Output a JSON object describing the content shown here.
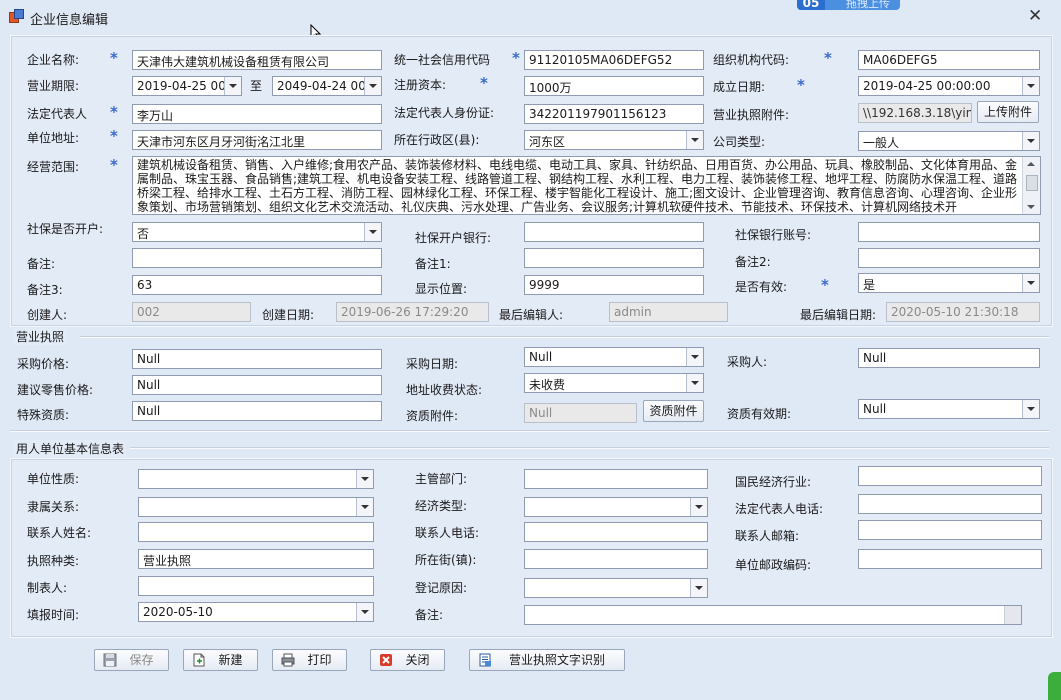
{
  "window": {
    "title": "企业信息编辑",
    "overlay_button": "拖拽上传",
    "overlay_logo": "05"
  },
  "company": {
    "name_label": "企业名称:",
    "name_value": "天津伟大建筑机械设备租赁有限公司",
    "credit_code_label": "统一社会信用代码",
    "credit_code_value": "91120105MA06DEFG52",
    "org_code_label": "组织机构代码:",
    "org_code_value": "MA06DEFG5",
    "term_label": "营业期限:",
    "term_start": "2019-04-25 00:",
    "term_to": "至",
    "term_end": "2049-04-24 00:",
    "capital_label": "注册资本:",
    "capital_value": "1000万",
    "established_label": "成立日期:",
    "established_value": "2019-04-25 00:00:00",
    "legal_rep_label": "法定代表人",
    "legal_rep_value": "李万山",
    "legal_id_label": "法定代表人身份证:",
    "legal_id_value": "342201197901156123",
    "license_attach_label": "营业执照附件:",
    "license_attach_value": "\\\\192.168.3.18\\yin",
    "upload_attach_button": "上传附件",
    "address_label": "单位地址:",
    "address_value": "天津市河东区月牙河街洺江北里",
    "district_label": "所在行政区(县):",
    "district_value": "河东区",
    "company_type_label": "公司类型:",
    "company_type_value": "一般人",
    "scope_label": "经营范围:",
    "scope_value": "建筑机械设备租赁、销售、入户维修;食用农产品、装饰装修材料、电线电缆、电动工具、家具、针纺织品、日用百货、办公用品、玩具、橡胶制品、文化体育用品、金属制品、珠宝玉器、食品销售;建筑工程、机电设备安装工程、线路管道工程、钢结构工程、水利工程、电力工程、装饰装修工程、地坪工程、防腐防水保温工程、道路桥梁工程、给排水工程、土石方工程、消防工程、园林绿化工程、环保工程、楼宇智能化工程设计、施工;图文设计、企业管理咨询、教育信息咨询、心理咨询、企业形象策划、市场营销策划、组织文化艺术交流活动、礼仪庆典、污水处理、广告业务、会议服务;计算机软硬件技术、节能技术、环保技术、计算机网络技术开",
    "social_open_label": "社保是否开户:",
    "social_open_value": "否",
    "social_bank_label": "社保开户银行:",
    "social_bank_value": "",
    "social_account_label": "社保银行账号:",
    "social_account_value": "",
    "remark_label": "备注:",
    "remark_value": "",
    "remark1_label": "备注1:",
    "remark1_value": "",
    "remark2_label": "备注2:",
    "remark2_value": "",
    "remark3_label": "备注3:",
    "remark3_value": "63",
    "display_pos_label": "显示位置:",
    "display_pos_value": "9999",
    "valid_label": "是否有效:",
    "valid_value": "是",
    "creator_label": "创建人:",
    "creator_value": "002",
    "created_date_label": "创建日期:",
    "created_date_value": "2019-06-26 17:29:20",
    "last_editor_label": "最后编辑人:",
    "last_editor_value": "admin",
    "last_edit_date_label": "最后编辑日期:",
    "last_edit_date_value": "2020-05-10 21:30:18"
  },
  "license": {
    "group_title": "营业执照",
    "purchase_price_label": "采购价格:",
    "purchase_price_value": "Null",
    "purchase_date_label": "采购日期:",
    "purchase_date_value": "Null",
    "purchaser_label": "采购人:",
    "purchaser_value": "Null",
    "retail_price_label": "建议零售价格:",
    "retail_price_value": "Null",
    "address_fee_label": "地址收费状态:",
    "address_fee_value": "未收费",
    "special_qual_label": "特殊资质:",
    "special_qual_value": "Null",
    "qual_attach_label": "资质附件:",
    "qual_attach_value": "Null",
    "qual_attach_button": "资质附件",
    "qual_valid_label": "资质有效期:",
    "qual_valid_value": "Null"
  },
  "employer": {
    "group_title": "用人单位基本信息表",
    "nature_label": "单位性质:",
    "nature_value": "",
    "dept_label": "主管部门:",
    "dept_value": "",
    "industry_label": "国民经济行业:",
    "industry_value": "",
    "affiliation_label": "隶属关系:",
    "affiliation_value": "",
    "economy_label": "经济类型:",
    "economy_value": "",
    "legal_phone_label": "法定代表人电话:",
    "legal_phone_value": "",
    "contact_name_label": "联系人姓名:",
    "contact_name_value": "",
    "contact_phone_label": "联系人电话:",
    "contact_phone_value": "",
    "contact_email_label": "联系人邮箱:",
    "contact_email_value": "",
    "license_type_label": "执照种类:",
    "license_type_value": "营业执照",
    "street_label": "所在街(镇):",
    "street_value": "",
    "postcode_label": "单位邮政编码:",
    "postcode_value": "",
    "preparer_label": "制表人:",
    "preparer_value": "",
    "reg_reason_label": "登记原因:",
    "reg_reason_value": "",
    "fill_time_label": "填报时间:",
    "fill_time_value": "2020-05-10",
    "remark_label": "备注:",
    "remark_value": ""
  },
  "toolbar": {
    "save": "保存",
    "new": "新建",
    "print": "打印",
    "close": "关闭",
    "ocr": "营业执照文字识别"
  },
  "colors": {
    "background": "#dfe8f5",
    "required_star": "#3a6ad0",
    "overlay_button": "#4b8fe0"
  }
}
